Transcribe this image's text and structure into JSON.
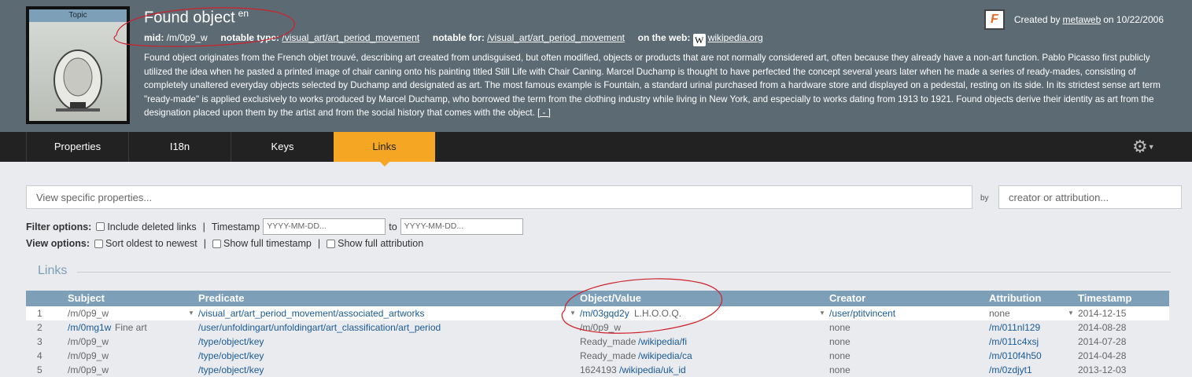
{
  "topic": {
    "thumb_label": "Topic",
    "title": "Found object",
    "lang": "en",
    "mid_label": "mid:",
    "mid": "/m/0p9_w",
    "notable_type_label": "notable type:",
    "notable_type": "/visual_art/art_period_movement",
    "notable_for_label": "notable for:",
    "notable_for": "/visual_art/art_period_movement",
    "on_web_label": "on the web:",
    "web_link": "wikipedia.org",
    "description": "Found object originates from the French objet trouvé, describing art created from undisguised, but often modified, objects or products that are not normally considered art, often because they already have a non-art function. Pablo Picasso first publicly utilized the idea when he pasted a printed image of chair caning onto his painting titled Still Life with Chair Caning. Marcel Duchamp is thought to have perfected the concept several years later when he made a series of ready-mades, consisting of completely unaltered everyday objects selected by Duchamp and designated as art. The most famous example is Fountain, a standard urinal purchased from a hardware store and displayed on a pedestal, resting on its side. In its strictest sense art term \"ready-made\" is applied exclusively to works produced by Marcel Duchamp, who borrowed the term from the clothing industry while living in New York, and especially to works dating from 1913 to 1921. Found objects derive their identity as art from the designation placed upon them by the artist and from the social history that comes with the object.",
    "more_link": "[ - ]",
    "created_prefix": "Created by",
    "created_user": "metaweb",
    "created_suffix": "on 10/22/2006"
  },
  "tabs": [
    {
      "label": "Properties"
    },
    {
      "label": "I18n"
    },
    {
      "label": "Keys"
    },
    {
      "label": "Links"
    }
  ],
  "filters": {
    "search_placeholder": "View specific properties...",
    "by_label": "by",
    "creator_placeholder": "creator or attribution...",
    "filter_label": "Filter options:",
    "include_deleted": "Include deleted links",
    "timestamp_label": "Timestamp",
    "date_placeholder": "YYYY-MM-DD...",
    "to_label": "to",
    "view_label": "View options:",
    "sort_oldest": "Sort oldest to newest",
    "show_full_timestamp": "Show full timestamp",
    "show_full_attribution": "Show full attribution",
    "pipe": "|"
  },
  "links": {
    "section_title": "Links",
    "columns": [
      "Subject",
      "Predicate",
      "Object/Value",
      "Creator",
      "Attribution",
      "Timestamp"
    ],
    "rows": [
      {
        "n": "1",
        "subject": "/m/0p9_w",
        "subject_extra": "",
        "predicate": "/visual_art/art_period_movement/associated_artworks",
        "object": "/m/03gqd2y",
        "object_text": "L.H.O.O.Q.",
        "creator": "/user/ptitvincent",
        "attribution": "none",
        "timestamp": "2014-12-15"
      },
      {
        "n": "2",
        "subject": "/m/0mg1w",
        "subject_extra": "Fine art",
        "predicate": "/user/unfoldingart/unfoldingart/art_classification/art_period",
        "object": "",
        "object_text": "/m/0p9_w",
        "creator": "none",
        "attribution": "/m/011nl129",
        "timestamp": "2014-08-28"
      },
      {
        "n": "3",
        "subject": "/m/0p9_w",
        "subject_extra": "",
        "predicate": "/type/object/key",
        "object": "/wikipedia/fi",
        "object_text": "Ready_made",
        "creator": "none",
        "attribution": "/m/011c4xsj",
        "timestamp": "2014-07-28"
      },
      {
        "n": "4",
        "subject": "/m/0p9_w",
        "subject_extra": "",
        "predicate": "/type/object/key",
        "object": "/wikipedia/ca",
        "object_text": "Ready_made",
        "creator": "none",
        "attribution": "/m/010f4h50",
        "timestamp": "2014-04-28"
      },
      {
        "n": "5",
        "subject": "/m/0p9_w",
        "subject_extra": "",
        "predicate": "/type/object/key",
        "object": "/wikipedia/uk_id",
        "object_text": "1624193",
        "creator": "none",
        "attribution": "/m/0zdjyt1",
        "timestamp": "2013-12-03"
      }
    ]
  },
  "colors": {
    "header_bg": "#5c6a74",
    "tab_active": "#f5a623",
    "table_header": "#7d9fb8",
    "annotation": "#d0202a"
  }
}
